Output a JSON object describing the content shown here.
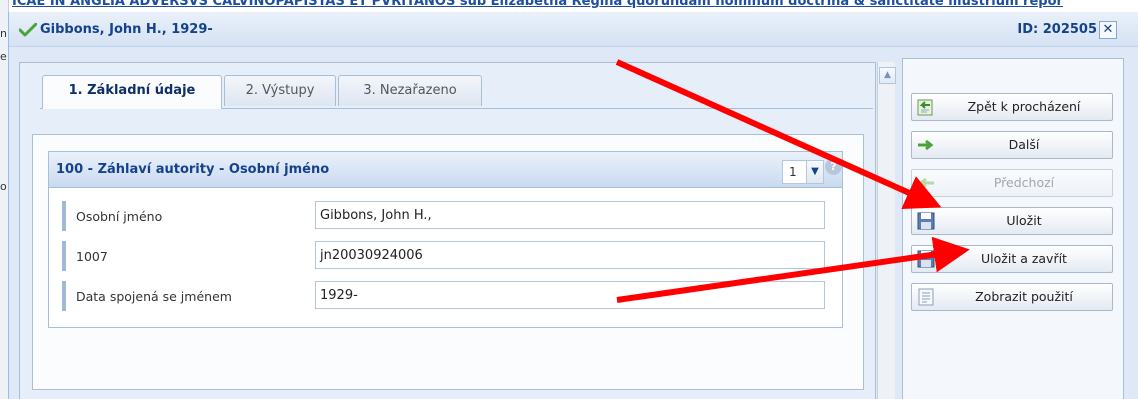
{
  "background": {
    "title": "ICAE IN ANGLIA ADVERSVS CALVINOPAPISTAS ET PVRITANOS sub Elizabetha Regina quorundam hominum doctrina & sanctitate illustrium repor",
    "left_marks": [
      "n",
      "e",
      "o"
    ]
  },
  "dialog": {
    "title": "Gibbons, John H., 1929-",
    "id_label": "ID: 202505",
    "close_glyph": "✕"
  },
  "tabs": [
    {
      "label": "1. Základní údaje",
      "active": true
    },
    {
      "label": "2. Výstupy",
      "active": false
    },
    {
      "label": "3. Nezařazeno",
      "active": false
    }
  ],
  "group": {
    "title": "100 - Záhlaví autority - Osobní jméno",
    "repeat_value": "1",
    "help_glyph": "?"
  },
  "fields": [
    {
      "label": "Osobní jméno",
      "value": "Gibbons, John H.,"
    },
    {
      "label": "1007",
      "value": "jn20030924006"
    },
    {
      "label": "Data spojená se jménem",
      "value": "1929-"
    }
  ],
  "actions": [
    {
      "label": "Zpět k procházení",
      "icon": "back-icon",
      "enabled": true
    },
    {
      "label": "Další",
      "icon": "arrow-right-icon",
      "enabled": true
    },
    {
      "label": "Předchozí",
      "icon": "arrow-left-icon",
      "enabled": false
    },
    {
      "label": "Uložit",
      "icon": "floppy-icon",
      "enabled": true
    },
    {
      "label": "Uložit a zavřít",
      "icon": "floppy-close-icon",
      "enabled": true
    },
    {
      "label": "Zobrazit použití",
      "icon": "document-icon",
      "enabled": true
    }
  ],
  "colors": {
    "accent": "#15428b",
    "annotation_arrow": "#ff0000"
  }
}
